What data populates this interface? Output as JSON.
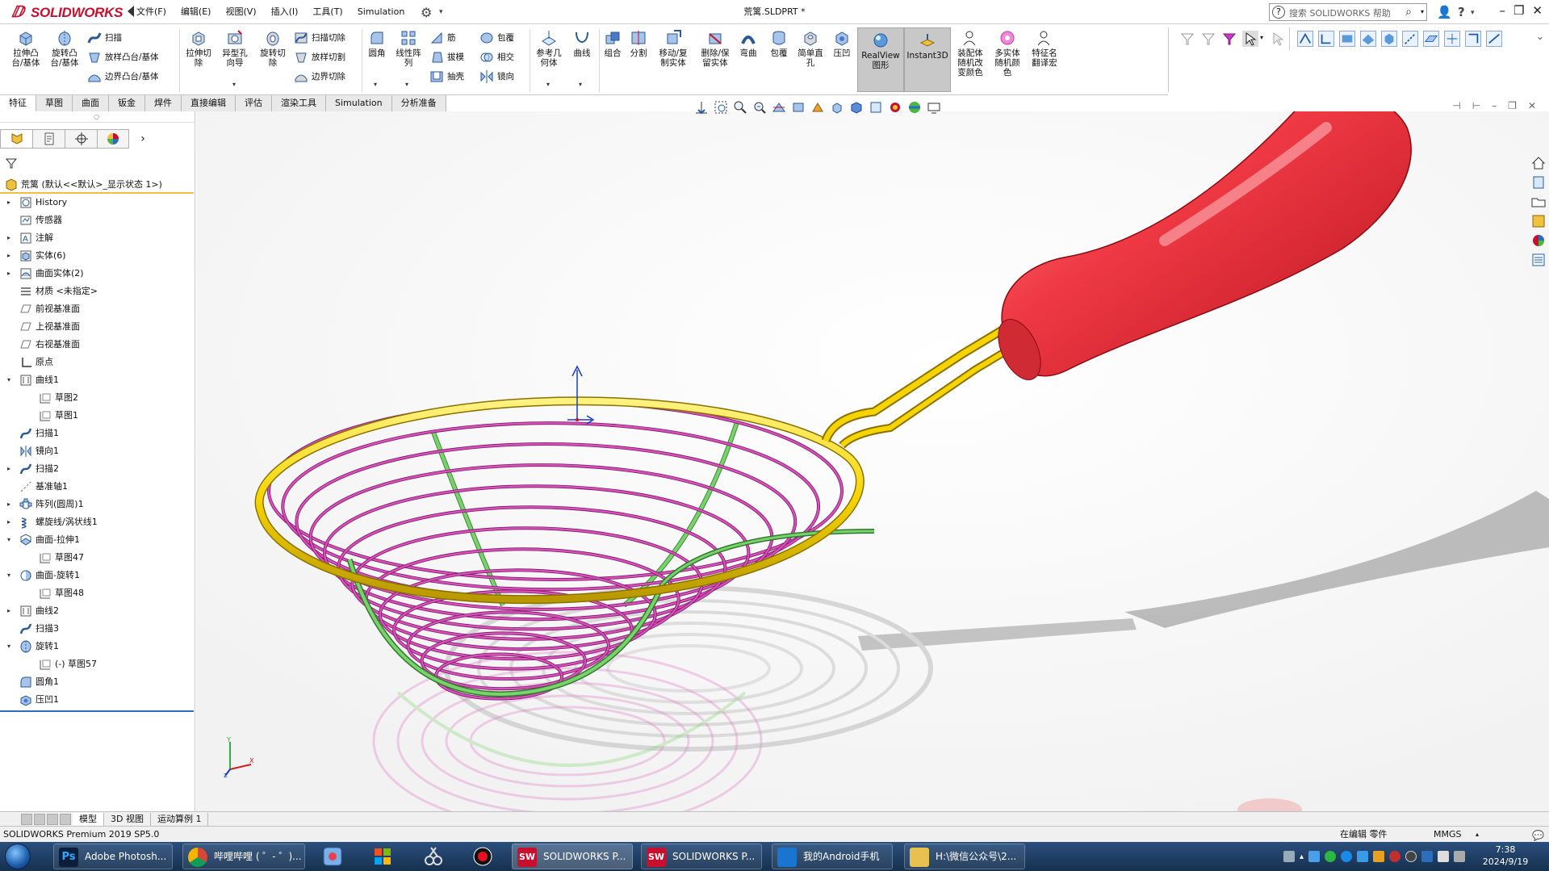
{
  "app": {
    "logo_text": "SOLIDWORKS",
    "doc_title": "荒篱.SLDPRT *",
    "menu": [
      "文件(F)",
      "编辑(E)",
      "视图(V)",
      "插入(I)",
      "工具(T)",
      "Simulation"
    ],
    "search_placeholder": "搜索 SOLIDWORKS 帮助"
  },
  "commands": {
    "extrude_boss": "拉伸凸\n台/基体",
    "revolve_boss": "旋转凸\n台/基体",
    "sweep": "扫描",
    "loft": "放样凸台/基体",
    "boundary": "边界凸台/基体",
    "extrude_cut": "拉伸切\n除",
    "hole_wizard": "异型孔\n向导",
    "revolve_cut": "旋转切\n除",
    "sweep_cut": "扫描切除",
    "loft_cut": "放样切割",
    "boundary_cut": "边界切除",
    "fillet": "圆角",
    "linear_pattern": "线性阵\n列",
    "rib": "筋",
    "draft": "拔模",
    "shell": "抽壳",
    "wrap": "包覆",
    "intersect": "相交",
    "mirror": "镜向",
    "ref_geom": "参考几\n何体",
    "curves": "曲线",
    "combine": "组合",
    "split": "分割",
    "move_copy": "移动/复\n制实体",
    "delete_keep": "删除/保\n留实体",
    "flex": "弯曲",
    "wrap2": "包覆",
    "simple_hole": "简单直\n孔",
    "indent": "压凹",
    "realview": "RealView\n图形",
    "instant3d": "Instant3D",
    "assembly_color": "装配体\n随机改\n变颜色",
    "multibody_color": "多实体\n随机颜\n色",
    "feature_translate": "特征名\n翻译宏"
  },
  "tabs": [
    "特征",
    "草图",
    "曲面",
    "钣金",
    "焊件",
    "直接编辑",
    "评估",
    "渲染工具",
    "Simulation",
    "分析准备"
  ],
  "active_tab": 0,
  "tree": {
    "root": "荒篱 (默认<<默认>_显示状态 1>)",
    "nodes": [
      {
        "label": "History",
        "level": 0,
        "tw": "▸",
        "icon": "history-icon"
      },
      {
        "label": "传感器",
        "level": 0,
        "tw": "",
        "icon": "sensor-icon"
      },
      {
        "label": "注解",
        "level": 0,
        "tw": "▸",
        "icon": "annotation-icon"
      },
      {
        "label": "实体(6)",
        "level": 0,
        "tw": "▸",
        "icon": "solid-bodies-icon"
      },
      {
        "label": "曲面实体(2)",
        "level": 0,
        "tw": "▸",
        "icon": "surface-bodies-icon"
      },
      {
        "label": "材质 <未指定>",
        "level": 0,
        "tw": "",
        "icon": "material-icon"
      },
      {
        "label": "前视基准面",
        "level": 0,
        "tw": "",
        "icon": "plane-icon"
      },
      {
        "label": "上视基准面",
        "level": 0,
        "tw": "",
        "icon": "plane-icon"
      },
      {
        "label": "右视基准面",
        "level": 0,
        "tw": "",
        "icon": "plane-icon"
      },
      {
        "label": "原点",
        "level": 0,
        "tw": "",
        "icon": "origin-icon"
      },
      {
        "label": "曲线1",
        "level": 0,
        "tw": "▾",
        "icon": "curve-icon"
      },
      {
        "label": "草图2",
        "level": 1,
        "tw": "",
        "icon": "sketch-icon"
      },
      {
        "label": "草图1",
        "level": 1,
        "tw": "",
        "icon": "sketch-icon"
      },
      {
        "label": "扫描1",
        "level": 0,
        "tw": "",
        "icon": "sweep-icon"
      },
      {
        "label": "镜向1",
        "level": 0,
        "tw": "",
        "icon": "mirror-icon"
      },
      {
        "label": "扫描2",
        "level": 0,
        "tw": "▸",
        "icon": "sweep-icon"
      },
      {
        "label": "基准轴1",
        "level": 0,
        "tw": "",
        "icon": "axis-icon"
      },
      {
        "label": "阵列(圆周)1",
        "level": 0,
        "tw": "▸",
        "icon": "circular-pattern-icon"
      },
      {
        "label": "螺旋线/涡状线1",
        "level": 0,
        "tw": "▸",
        "icon": "helix-icon"
      },
      {
        "label": "曲面-拉伸1",
        "level": 0,
        "tw": "▾",
        "icon": "surface-extrude-icon"
      },
      {
        "label": "草图47",
        "level": 1,
        "tw": "",
        "icon": "sketch-icon"
      },
      {
        "label": "曲面-旋转1",
        "level": 0,
        "tw": "▾",
        "icon": "surface-revolve-icon"
      },
      {
        "label": "草图48",
        "level": 1,
        "tw": "",
        "icon": "sketch-icon"
      },
      {
        "label": "曲线2",
        "level": 0,
        "tw": "▸",
        "icon": "curve-icon"
      },
      {
        "label": "扫描3",
        "level": 0,
        "tw": "",
        "icon": "sweep-icon"
      },
      {
        "label": "旋转1",
        "level": 0,
        "tw": "▾",
        "icon": "revolve-icon"
      },
      {
        "label": "(-) 草图57",
        "level": 1,
        "tw": "",
        "icon": "sketch-icon"
      },
      {
        "label": "圆角1",
        "level": 0,
        "tw": "",
        "icon": "fillet-icon"
      },
      {
        "label": "压凹1",
        "level": 0,
        "tw": "",
        "icon": "indent-icon"
      }
    ]
  },
  "bottom_tabs": [
    "模型",
    "3D 视图",
    "运动算例 1"
  ],
  "status": {
    "product": "SOLIDWORKS Premium 2019 SP5.0",
    "editing": "在编辑 零件",
    "units": "MMGS"
  },
  "taskbar": {
    "tasks": [
      {
        "label": "Adobe Photosh...",
        "color": "#0c1f3a"
      },
      {
        "label": "哔哩哔哩 ( ゜- ゜)...",
        "color": "#e0a020"
      },
      {
        "label": "SOLIDWORKS P...",
        "color": "#c8102e"
      },
      {
        "label": "SOLIDWORKS P...",
        "color": "#c8102e"
      },
      {
        "label": "我的Android手机",
        "color": "#1a75d1"
      },
      {
        "label": "H:\\微信公众号\\2...",
        "color": "#e8c050"
      }
    ],
    "time": "7:38",
    "date": "2024/9/19"
  },
  "colors": {
    "handle": "#e8323c",
    "rim": "#f5d400",
    "mesh": "#d850b8",
    "ribs": "#7ad36a",
    "accent": "#1a5ca8"
  }
}
